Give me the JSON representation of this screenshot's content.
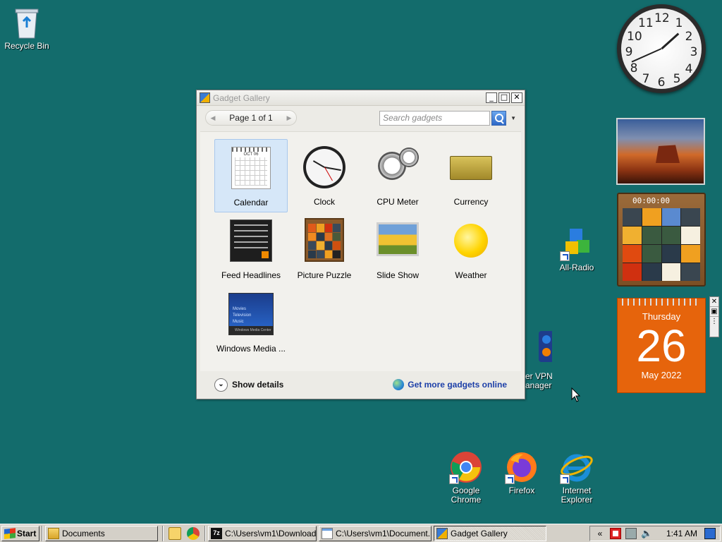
{
  "desktop": {
    "icons": [
      {
        "label": "Recycle Bin"
      },
      {
        "label": "All-Radio"
      },
      {
        "label": "er VPN\nanager"
      },
      {
        "label": "Google Chrome"
      },
      {
        "label": "Firefox"
      },
      {
        "label": "Internet Explorer"
      }
    ]
  },
  "window": {
    "title": "Gadget Gallery",
    "minimize": "_",
    "maximize": "□",
    "close": "✕",
    "pager_label": "Page 1 of 1",
    "prev_arrow": "◀",
    "next_arrow": "▶",
    "search_placeholder": "Search gadgets",
    "dropdown_arrow": "▼",
    "gadgets": [
      {
        "name": "Calendar",
        "selected": true
      },
      {
        "name": "Clock"
      },
      {
        "name": "CPU Meter"
      },
      {
        "name": "Currency"
      },
      {
        "name": "Feed Headlines"
      },
      {
        "name": "Picture Puzzle"
      },
      {
        "name": "Slide Show"
      },
      {
        "name": "Weather"
      },
      {
        "name": "Windows Media ..."
      }
    ],
    "show_details": "Show details",
    "get_more": "Get more gadgets online",
    "calendar_thumb_month": "OCT 06",
    "wmc_lines": [
      "Movies",
      "Television",
      "Music"
    ],
    "wmc_bar": "Windows Media Center"
  },
  "gadgets": {
    "clock_numbers": [
      "12",
      "1",
      "2",
      "3",
      "4",
      "5",
      "6",
      "7",
      "8",
      "9",
      "10",
      "11"
    ],
    "puzzle_timer": "00:00:00",
    "calendar_day": "Thursday",
    "calendar_date": "26",
    "calendar_month": "May 2022",
    "ctrl_close": "✕",
    "ctrl_options": "▣",
    "ctrl_drag": "⋮"
  },
  "taskbar": {
    "start": "Start",
    "tasks": [
      {
        "label": "Documents"
      },
      {
        "label": "C:\\Users\\vm1\\Download..."
      },
      {
        "label": "C:\\Users\\vm1\\Document..."
      },
      {
        "label": "Gadget Gallery"
      }
    ],
    "tray_expand": "«",
    "time": "1:41 AM"
  },
  "colors": {
    "desktop": "#136c6c",
    "calendar_gadget": "#e6640c",
    "link": "#1c3fa8",
    "selected_tile": "#d6e7f8"
  }
}
